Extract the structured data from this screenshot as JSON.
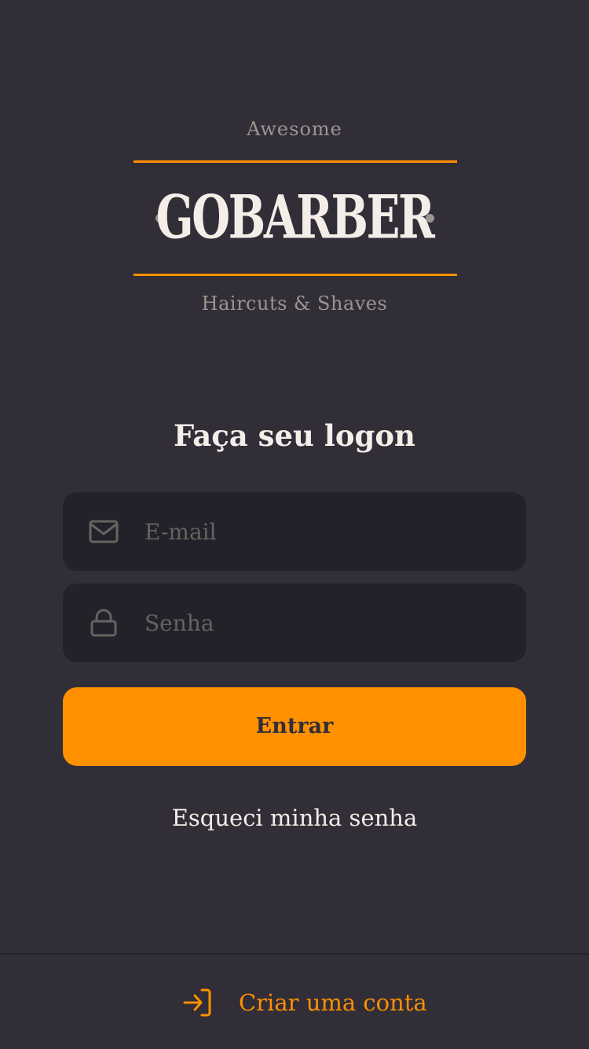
{
  "logo": {
    "top_text": "Awesome",
    "brand": "GOBARBER",
    "bottom_text": "Haircuts & Shaves"
  },
  "form": {
    "title": "Faça seu logon",
    "email": {
      "placeholder": "E-mail",
      "value": "",
      "icon": "mail-icon"
    },
    "password": {
      "placeholder": "Senha",
      "value": "",
      "icon": "lock-icon"
    },
    "submit_label": "Entrar",
    "forgot_label": "Esqueci minha senha"
  },
  "footer": {
    "create_account_label": "Criar uma conta",
    "icon": "log-in-icon"
  },
  "colors": {
    "background": "#312e38",
    "input_background": "#232129",
    "accent": "#ff9000",
    "text": "#f4ede8",
    "muted": "#999591",
    "placeholder": "#666360"
  }
}
